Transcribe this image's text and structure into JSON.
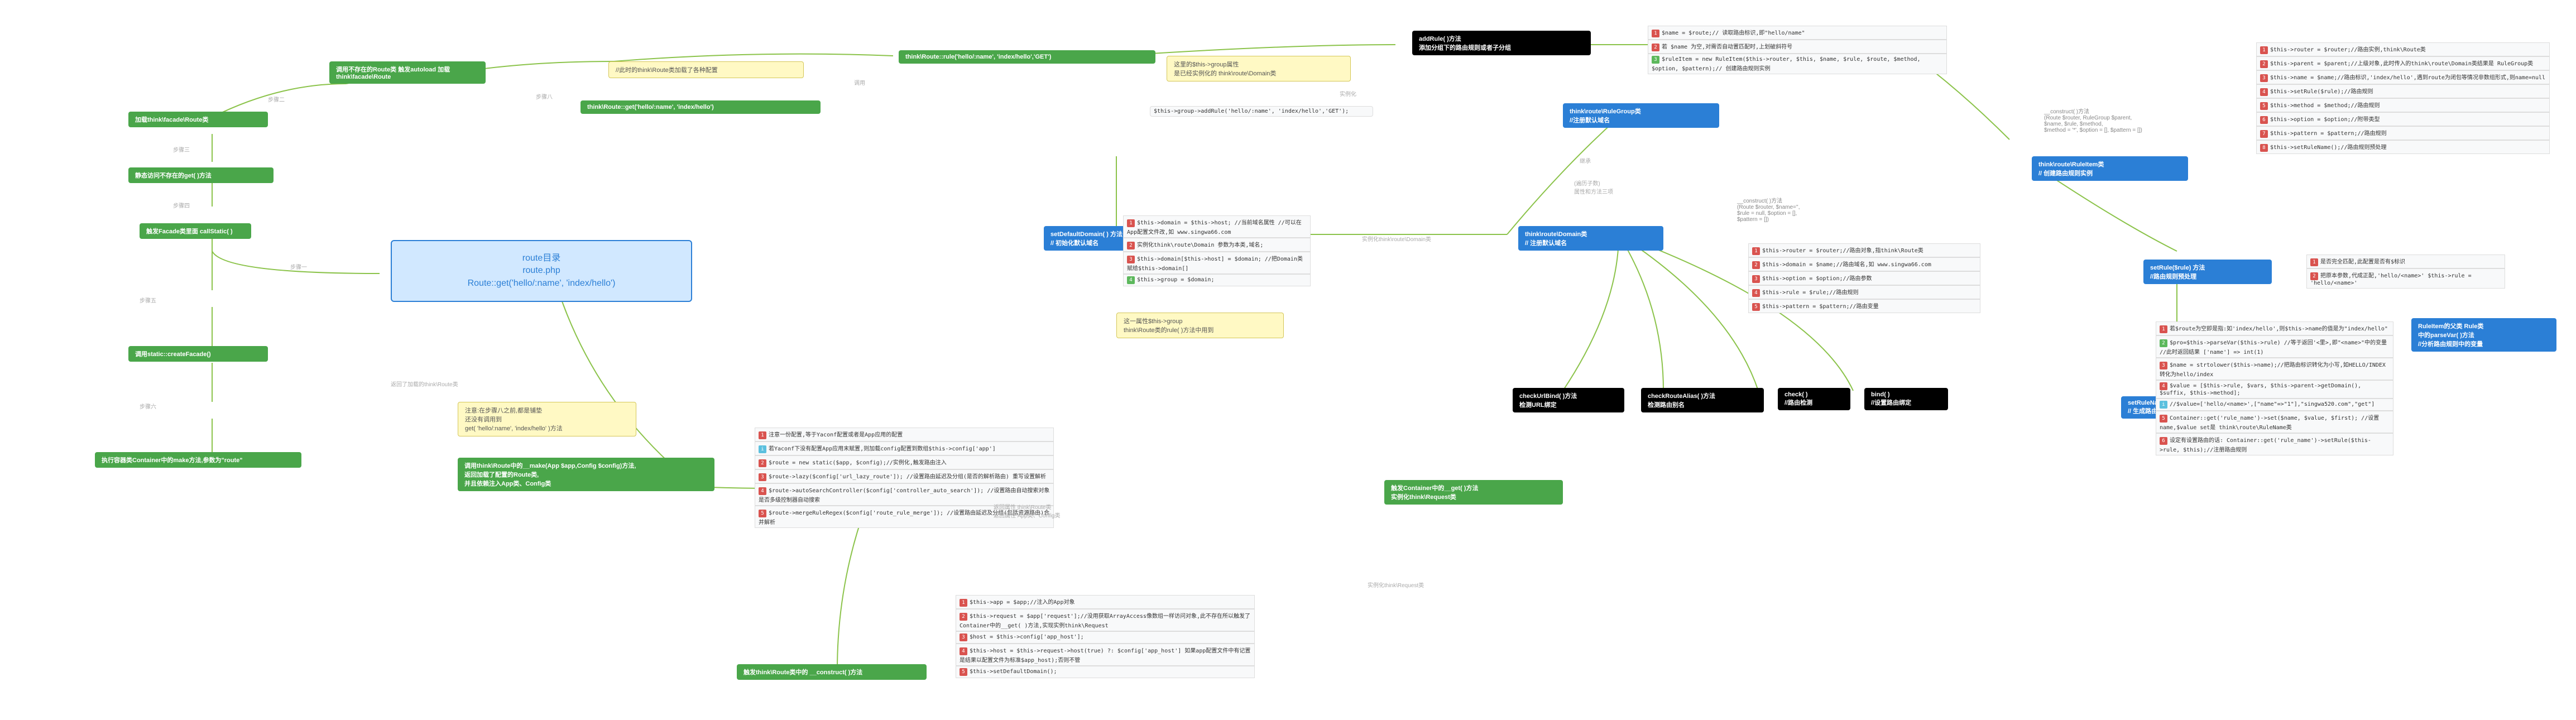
{
  "root": {
    "line1": "route目录",
    "line2": "route.php",
    "line3": "Route::get('hello/:name', 'index/hello')"
  },
  "left_chain": {
    "n1": "调用不存在的Route类\n触发autoload\n加载think\\facade\\Route",
    "n2": "加载think\\facade\\Route类",
    "n3": "静态访问不存在的get( )方法",
    "n4": "触发Facade类里面\ncallStatic( )",
    "n5": "调用static::createFacade()",
    "n6": "执行容器类Container中的make方法,参数为\"route\""
  },
  "yellow_notes": {
    "y1": "//此时的think\\Route类加载了各种配置",
    "y2": "注意:在步骤八之前,都是铺垫\n还没有调用到\nget( 'hello/:name', 'index/hello' )方法",
    "y3": "这里的$this->group属性\n是已经实例化的 think\\route\\Domain类",
    "y4": "这一属性$this->group\nthink\\Route类的rule( )方法中用到"
  },
  "green_nodes": {
    "g1": "think\\Route::get('hello/:name', 'index/hello')",
    "g2": "think\\Route::rule('hello/:name', 'index/hello','GET')",
    "g3": "调用think\\Route中的__make(App $app,Config $config)方法,\n返回加载了配置的Route类,\n并且依赖注入App类、Config类",
    "g4": "触发think\\Route类中的 __construct( )方法",
    "g5": "触发Container中的__get( )方法\n实例化think\\Request类"
  },
  "blue_nodes": {
    "b1": "setDefaultDomain( ) 方法\n// 初始化默认域名",
    "b2": "think\\route\\Domain类\n// 注册默认域名",
    "b3": "think\\route\\RuleGroup类\n//注册默认域名",
    "b4": "think\\route\\RuleItem类\n// 创建路由规则实例",
    "b5": "setRule($rule) 方法\n//路由规则预处理",
    "b6": "setRuleName($first = false)\n// 生成路由标识的快捷访问",
    "b7": "RuleItem的父类 Rule类\n中的parseVar( )方法\n//分析路由规则中的变量"
  },
  "black_nodes": {
    "k1": "addRule( )方法\n添加分组下的路由规则或者子分组",
    "k2": "checkUrlBind( )方法\n检测URL绑定",
    "k3": "checkRouteAlias( )方法\n检测路由别名",
    "k4": "check( )\n//路由检测",
    "k5": "bind( )\n//设置路由绑定"
  },
  "construct_notes": {
    "c1": "__construct( )方法\n(Route $router, $name='',\n$rule = null, $option = [],\n$pattern = [])",
    "c2": "__construct( )方法\n(Route $router, RuleGroup $parent,\n$name, $rule, $method,\n$method = '*', $option = [], $pattern = [])"
  },
  "code_blocks": {
    "make_list": {
      "title": "注意一份配置,等于Yaconf配置或者是App应用的配置",
      "items": [
        "若Yaconf下没有配置App应用末赋置,则加载config配置到数组$this->config['app']",
        "$route = new static($app, $config);//实例化,触发路由注入",
        "$route->lazy($config['url_lazy_route']);\n//设置路由延迟及分组(是否的解析路由) 重写设置解析",
        "$route->autoSearchController($config['controller_auto_search']);\n//设置路由自动搜索对象是否多级控制器自动搜索",
        "$route->mergeRuleRegex($config['route_rule_merge']);\n//设置路由延迟及分组(包括资源路由)合并解析"
      ]
    },
    "construct_list": {
      "title": "$this->app = $app;//注入的App对象",
      "items": [
        "$this->request = $app['request'];//没用获取ArrayAccess像数组一样访问对象,此不存在所以触发了Container中的__get( )方法,实现实例think\\Request",
        "$host = $this->config['app_host'];",
        "$this->host = $this->request->host(true) ?: $config['app_host']\n如果app配置文件中有记置是结果以配置文件为标准$app_host);否则不管",
        "$this->setDefaultDomain();"
      ]
    },
    "domain_list": {
      "items": [
        "$this->domain = $this->host; //当前域名属性\n//可以在App配置文件改,如 www.singwa66.com",
        "实例化think\\route\\Domain 参数为本类,域名;",
        "$this->domain[$this->host] = $domain;\n//把Domain类赋给$this->domain[]",
        "$this->group = $domain;"
      ]
    },
    "domain_inst_list": {
      "items": [
        "$this->router = $router;//路由对象,指think\\Route类",
        "$this->domain = $name;//路由域名,如 www.singwa66.com",
        "$this->option = $option;//路由参数",
        "$this->rule = $rule;//路由规则",
        "$this->pattern = $pattern;//路由变量"
      ]
    },
    "addrule_list": {
      "items": [
        "$name = $route;// 读取路由标识,即\"hello/name\"",
        "若 $name 为空,对需否自动置匹配时,上划破斜符号",
        "$ruleItem = new RuleItem($this->router, $this, $name, $rule, $route, $method,\n$option, $pattern);// 创建路由规则实例"
      ]
    },
    "ruleitem_list": {
      "items": [
        "$this->router = $router;//路由实例,think\\Route类",
        "$this->parent = $parent;//上级对象,此时传入的think\\route\\Domain类结果是 RuleGroup类",
        "$this->name = $name;//路由标识,'index/hello',遇到route为闭包等情况非数组形式,则name=null",
        "$this->setRule($rule);//路由规则",
        "$this->method = $method;//路由规则",
        "$this->option = $option;//附带类型",
        "$this->pattern = $pattern;//路由规则",
        "$this->setRuleName();//路由规则预处理"
      ]
    },
    "setrule_list": {
      "items": [
        "是否完全匹配,此配置是否有$标识",
        "把原本参数,代成正配,'hello/<name>'\n$this->rule = 'hello/<name>'"
      ]
    },
    "setrulename_list": {
      "items": [
        "若$route为空即是指:如'index/hello',则$this->name的值是为\"index/hello\"",
        "$pro=$this->parseVar($this->rule)\n//等于返回'<里>,即\"<name>\"中的变量\n//此时返回结果\n['name'] => int(1)",
        "$name = strtolower($this->name);//把路由标识转化为小写,如HELLO/INDEX转化为hello/index",
        "$value = [$this->rule, $vars, $this->parent->getDomain(), $suffix, $this->method];",
        "//$value=['hello/<name>',[\"name\"=>\"1\"],\"singwa520.com\",\"get\"]",
        "Container::get('rule_name')->set($name, $value, $first);\n//设置 name,$value set是 think\\route\\RuleName类",
        "设定有设置路由的话:\nContainer::get('rule_name')->setRule($this->rule, $this);//注册路由规则"
      ]
    },
    "addrule_call": "$this->group->addRule('hello/:name', 'index/hello','GET');"
  },
  "edge_labels": {
    "e1": "步骤一",
    "e2": "步骤二",
    "e3": "步骤三",
    "e4": "步骤四",
    "e5": "步骤五",
    "e6": "步骤六",
    "e7": "返回了加载的think\\Route类",
    "e8": "步骤八",
    "e9": "调用",
    "e10": "实例化",
    "e11": "实例化think\\route\\Domain类",
    "e12": "继承",
    "e13": "(遍历子数)\n属性和方法三项",
    "e14": "返回属性 think\\Route类\n返回属性 App类、Config类",
    "e15": "实例化think\\Request类"
  }
}
